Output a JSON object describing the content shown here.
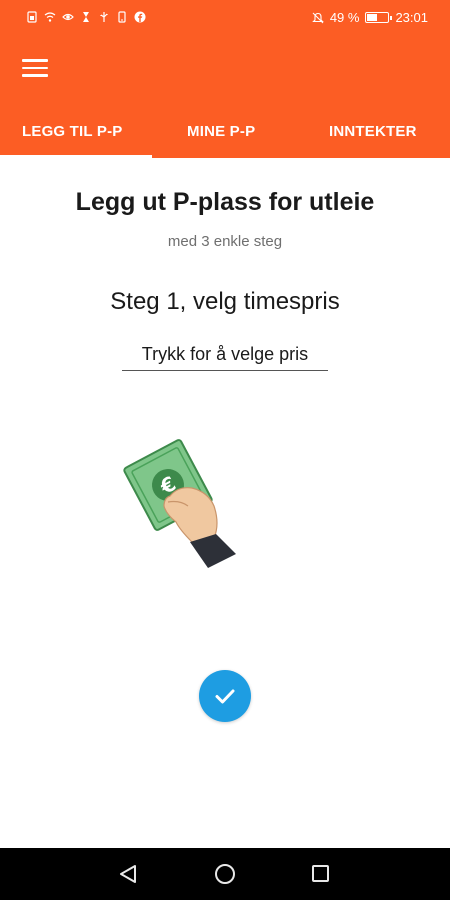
{
  "status_bar": {
    "icons": [
      "sim-icon",
      "wifi-icon",
      "eye-icon",
      "hourglass-icon",
      "usb-icon",
      "phone-icon",
      "facebook-icon"
    ],
    "battery_percent": "49 %",
    "battery_level": 0.49,
    "time": "23:01"
  },
  "header": {
    "menu_icon": "hamburger-menu-icon",
    "tabs": [
      {
        "label": "LEGG TIL P-P",
        "active": true
      },
      {
        "label": "MINE P-P",
        "active": false
      },
      {
        "label": "INNTEKTER",
        "active": false
      }
    ]
  },
  "main": {
    "title": "Legg ut P-plass for utleie",
    "subtitle": "med 3 enkle steg",
    "step_heading": "Steg 1, velg timespris",
    "price_picker": "Trykk for å velge pris",
    "illustration": "hand-holding-euro-note",
    "confirm_icon": "checkmark-icon"
  },
  "colors": {
    "accent": "#fc5d24",
    "confirm": "#1e9de2"
  },
  "nav_bar": {
    "buttons": [
      "back",
      "home",
      "recents"
    ]
  }
}
